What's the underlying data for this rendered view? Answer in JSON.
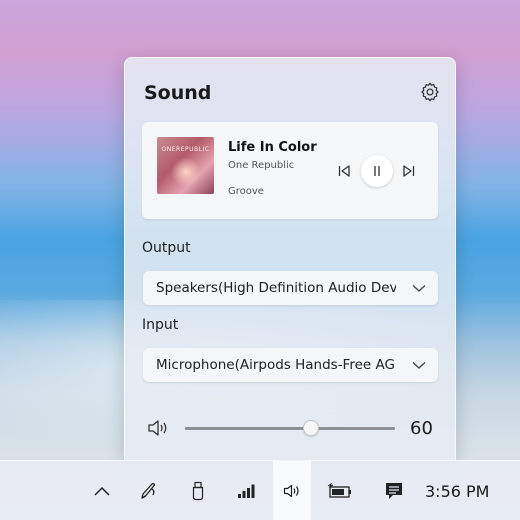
{
  "flyout": {
    "title": "Sound",
    "settings_icon": "gear-icon"
  },
  "media": {
    "album_text": "ONEREPUBLIC",
    "title": "Life In Color",
    "artist": "One Republic",
    "app": "Groove",
    "controls": [
      "previous-track-icon",
      "pause-icon",
      "next-track-icon"
    ],
    "playing": true
  },
  "output": {
    "label": "Output",
    "selected": "Speakers(High Definition Audio Device)"
  },
  "input": {
    "label": "Input",
    "selected": "Microphone(Airpods Hands-Free AG Audio)"
  },
  "volume": {
    "icon": "speaker-icon",
    "value": 60,
    "display": "60"
  },
  "taskbar": {
    "icons": [
      "chevron-up-icon",
      "pen-icon",
      "usb-drive-icon",
      "network-signal-icon",
      "volume-icon",
      "battery-icon",
      "notification-icon"
    ],
    "active_icon": "volume-icon",
    "time": "3:56 PM"
  },
  "colors": {
    "panel": "#e8ecf3",
    "text": "#1a1a1a",
    "slider": "#8e9096"
  }
}
